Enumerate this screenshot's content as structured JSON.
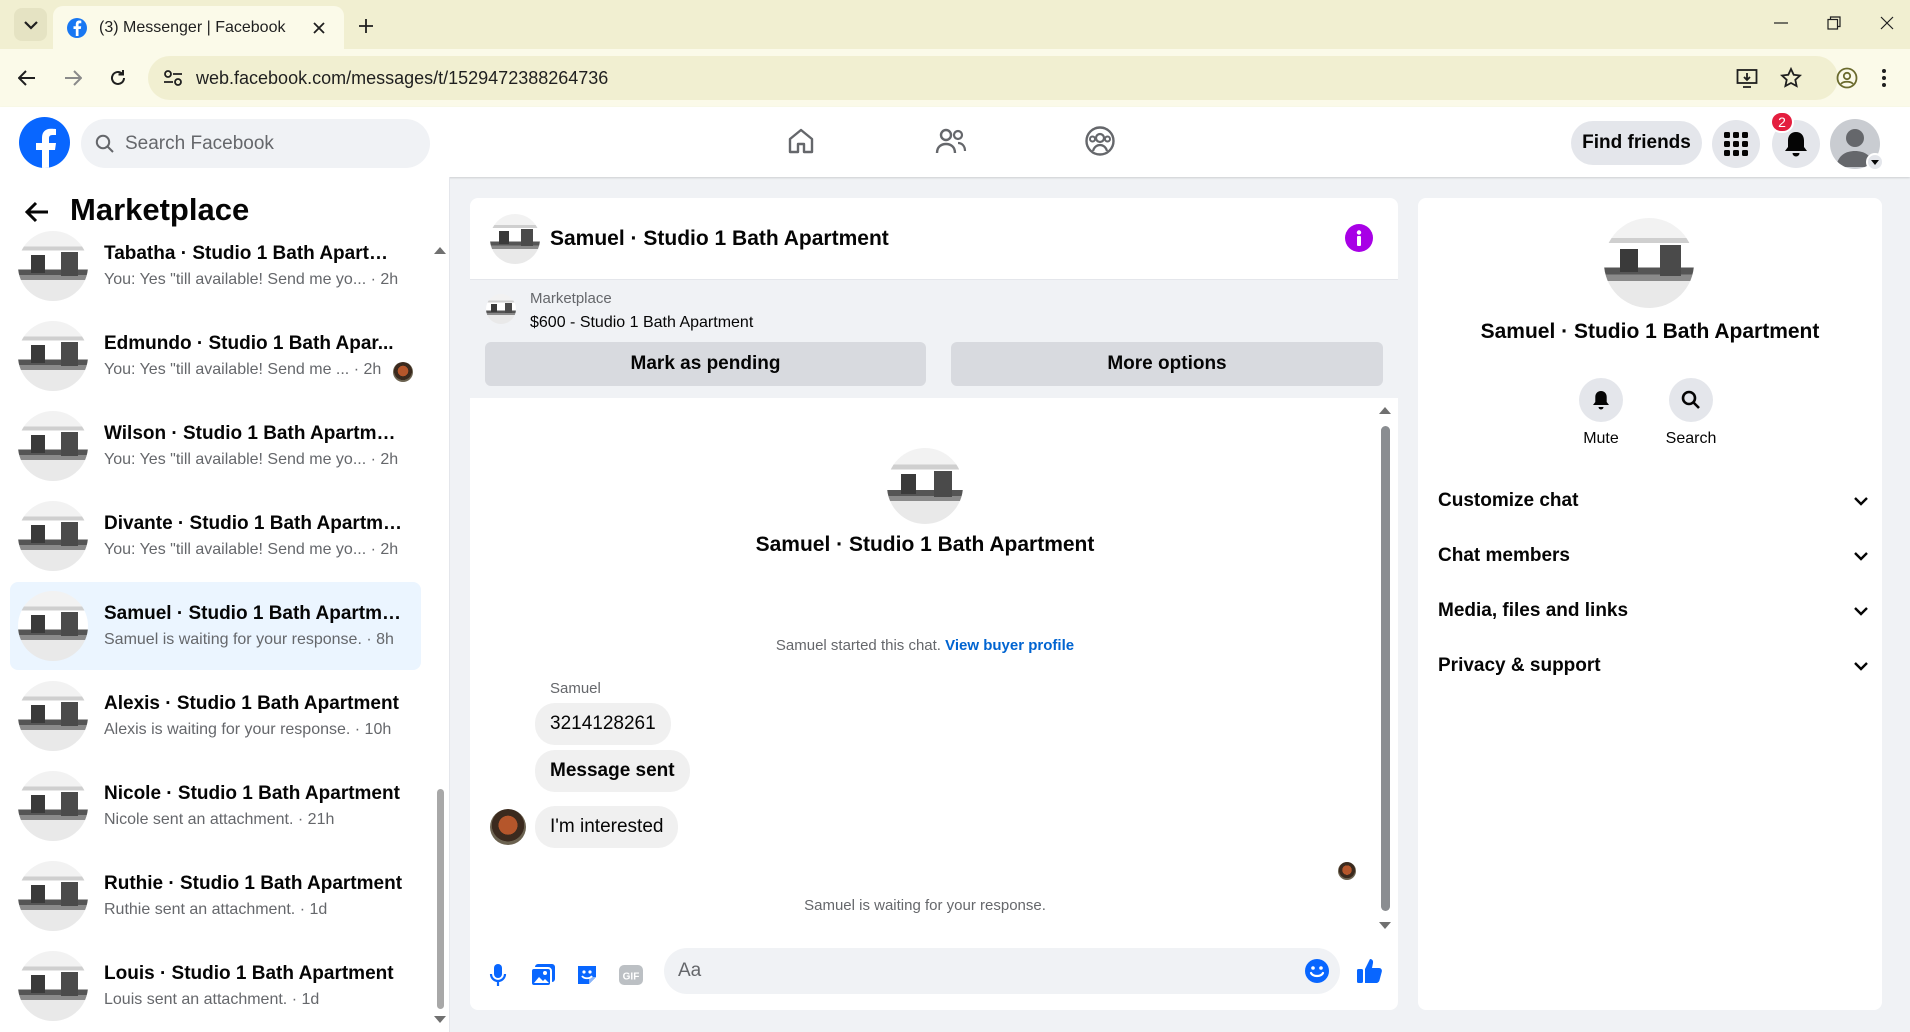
{
  "browser": {
    "tab_title": "(3) Messenger | Facebook",
    "url": "web.facebook.com/messages/t/1529472388264736"
  },
  "header": {
    "search_placeholder": "Search Facebook",
    "find_friends": "Find friends",
    "notification_count": "2"
  },
  "sidebar": {
    "title": "Marketplace",
    "conversations": [
      {
        "name": "Tabatha · Studio 1 Bath Apartment",
        "preview": "You: Yes \"till available! Send me yo...",
        "time": "· 2h"
      },
      {
        "name": "Edmundo · Studio 1 Bath Apar...",
        "preview": "You: Yes \"till available! Send me ...",
        "time": "· 2h"
      },
      {
        "name": "Wilson · Studio 1 Bath Apartment",
        "preview": "You: Yes \"till available! Send me yo...",
        "time": "· 2h"
      },
      {
        "name": "Divante · Studio 1 Bath Apartment",
        "preview": "You: Yes \"till available! Send me yo...",
        "time": "· 2h"
      },
      {
        "name": "Samuel · Studio 1 Bath Apartment",
        "preview": "Samuel is waiting for your response.",
        "time": "· 8h"
      },
      {
        "name": "Alexis · Studio 1 Bath Apartment",
        "preview": "Alexis is waiting for your response.",
        "time": "· 10h"
      },
      {
        "name": "Nicole · Studio 1 Bath Apartment",
        "preview": "Nicole sent an attachment.",
        "time": "· 21h"
      },
      {
        "name": "Ruthie · Studio 1 Bath Apartment",
        "preview": "Ruthie sent an attachment.",
        "time": "· 1d"
      },
      {
        "name": "Louis · Studio 1 Bath Apartment",
        "preview": "Louis sent an attachment.",
        "time": "· 1d"
      }
    ]
  },
  "chat": {
    "title": "Samuel · Studio 1 Bath Apartment",
    "listing_label": "Marketplace",
    "listing_title": "$600 - Studio 1 Bath Apartment",
    "mark_pending": "Mark as pending",
    "more_options": "More options",
    "intro_name": "Samuel · Studio 1 Bath Apartment",
    "started_text": "Samuel started this chat.",
    "view_profile": "View buyer profile",
    "sender": "Samuel",
    "messages": [
      "3214128261",
      "Message sent",
      "I'm interested"
    ],
    "waiting": "Samuel is waiting for your response.",
    "input_placeholder": "Aa"
  },
  "details": {
    "name": "Samuel · Studio 1 Bath Apartment",
    "mute": "Mute",
    "search": "Search",
    "sections": [
      "Customize chat",
      "Chat members",
      "Media, files and links",
      "Privacy & support"
    ]
  },
  "colors": {
    "brand": "#0866ff",
    "accent_purple": "#a800e6",
    "badge": "#e41e3f",
    "link": "#0064d1"
  }
}
